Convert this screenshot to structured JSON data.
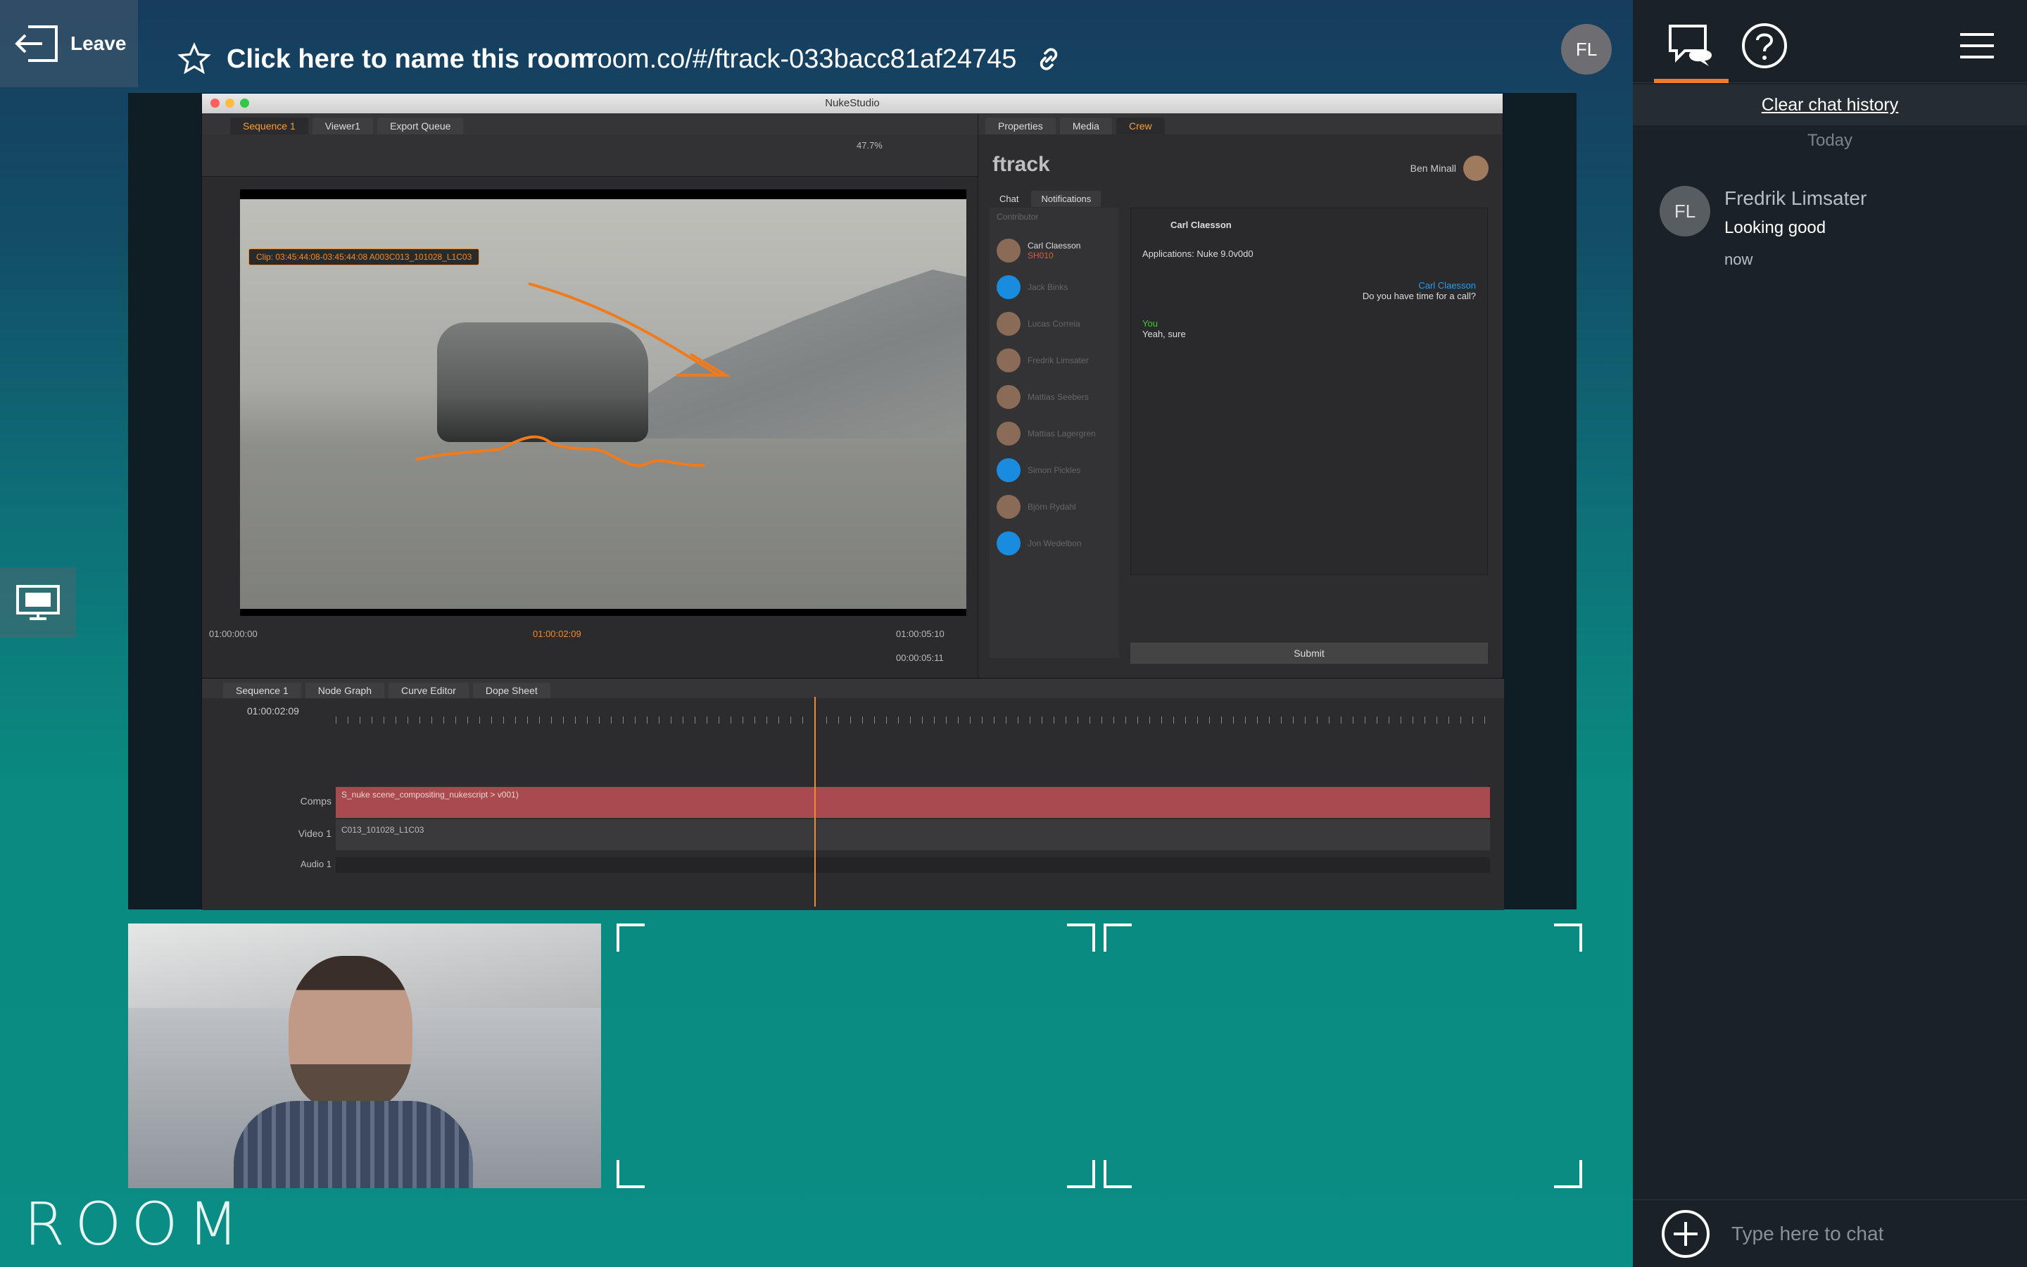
{
  "header": {
    "leave_label": "Leave",
    "room_name": "Click here to name this room",
    "room_url": "room.co/#/ftrack-033bacc81af24745",
    "user_initials": "FL"
  },
  "shared_screen": {
    "window_title": "NukeStudio",
    "top_tabs": [
      "Sequence 1",
      "Viewer1",
      "Export Queue"
    ],
    "right_tabs": [
      "Properties",
      "Media",
      "Crew"
    ],
    "clip_label": "Clip: 03:45:44:08-03:45:44:08 A003C013_101028_L1C03",
    "timecode_start": "01:00:00:00",
    "timecode_current": "01:00:02:09",
    "timecode_end": "01:00:05:10",
    "timecode_duration": "00:00:05:11",
    "zoom": "47.7%",
    "ftrack": {
      "logo": "ftrack",
      "current_user": "Ben Minall",
      "subtabs": [
        "Chat",
        "Notifications"
      ],
      "roster_header": "Contributor",
      "active_contact": "Carl Claesson",
      "active_contact_sub": "SH010",
      "contacts": [
        "Jack Binks",
        "Lucas Correia",
        "Fredrik Limsater",
        "Mattias Seebers",
        "Mattias Lagergren",
        "Simon Pickles",
        "Björn Rydahl",
        "Jon Wedelbon"
      ],
      "chat_header_name": "Carl Claesson",
      "applications": "Applications: Nuke 9.0v0d0",
      "message_from": "Carl Claesson",
      "message_text": "Do you have time for a call?",
      "reply_from": "You",
      "reply_text": "Yeah, sure",
      "submit_label": "Submit"
    },
    "timeline": {
      "tabs": [
        "Sequence 1",
        "Node Graph",
        "Curve Editor",
        "Dope Sheet"
      ],
      "timecode": "01:00:02:09",
      "tracks": [
        "Comps",
        "Video 1",
        "Audio 1"
      ],
      "comp_clip": "S_nuke scene_compositing_nukescript > v001)",
      "video_clip": "C013_101028_L1C03"
    }
  },
  "sidebar": {
    "clear_label": "Clear chat history",
    "date_label": "Today",
    "messages": [
      {
        "initials": "FL",
        "name": "Fredrik Limsater",
        "text": "Looking good",
        "time": "now"
      }
    ],
    "input_placeholder": "Type here to chat"
  },
  "brand": {
    "logo_text": "ROOM"
  },
  "colors": {
    "accent": "#f07b2c",
    "sidebar_bg": "#1b2227"
  },
  "icons": [
    "leave-icon",
    "star-icon",
    "link-icon",
    "screen-share-icon",
    "chat-icon",
    "help-icon",
    "menu-icon",
    "add-icon"
  ]
}
